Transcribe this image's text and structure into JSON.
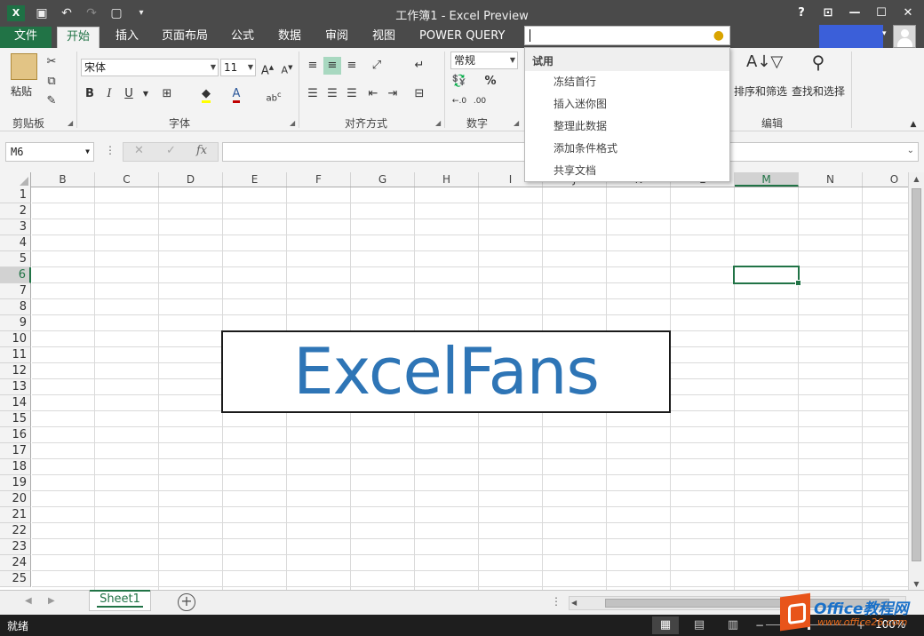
{
  "window": {
    "app_icon": "X",
    "title": "工作簿1 - Excel Preview",
    "controls": [
      "?",
      "⊡",
      "—",
      "☐",
      "✕"
    ]
  },
  "qat": {
    "icons": [
      "save-icon",
      "undo-icon",
      "redo-icon",
      "new-doc-icon",
      "customize-icon"
    ]
  },
  "tabs": [
    {
      "label": "文件"
    },
    {
      "label": "开始"
    },
    {
      "label": "插入"
    },
    {
      "label": "页面布局"
    },
    {
      "label": "公式"
    },
    {
      "label": "数据"
    },
    {
      "label": "审阅"
    },
    {
      "label": "视图"
    },
    {
      "label": "POWER QUERY"
    }
  ],
  "ribbon": {
    "clipboard": {
      "paste": "粘贴",
      "label": "剪贴板"
    },
    "font": {
      "name": "宋体",
      "size": "11",
      "label": "字体",
      "bold": "B",
      "italic": "I",
      "underline": "U"
    },
    "align": {
      "label": "对齐方式"
    },
    "number": {
      "format": "常规",
      "percent": "%",
      "label": "数字"
    },
    "editing": {
      "sort": "排序和筛选",
      "find": "查找和选择",
      "label": "编辑"
    }
  },
  "tellme": {
    "header": "试用",
    "items": [
      "冻结首行",
      "插入迷你图",
      "整理此数据",
      "添加条件格式",
      "共享文档"
    ]
  },
  "formula_bar": {
    "name_box": "M6",
    "fx": "fx",
    "cancel": "✕",
    "enter": "✓"
  },
  "grid": {
    "columns": [
      "B",
      "C",
      "D",
      "E",
      "F",
      "G",
      "H",
      "I",
      "J",
      "K",
      "L",
      "M",
      "N",
      "O"
    ],
    "rows": [
      "1",
      "2",
      "3",
      "4",
      "5",
      "6",
      "7",
      "8",
      "9",
      "10",
      "11",
      "12",
      "13",
      "14",
      "15",
      "16",
      "17",
      "18",
      "19",
      "20",
      "21",
      "22",
      "23",
      "24",
      "25"
    ],
    "selected_column": "M",
    "selected_row": "6",
    "textbox_text": "ExcelFans"
  },
  "sheets": {
    "tabs": [
      "Sheet1"
    ],
    "add": "+"
  },
  "status": {
    "ready": "就绪",
    "zoom": "100%"
  },
  "watermark": {
    "line1": "Office教程网",
    "line2": "www.office26.com"
  }
}
